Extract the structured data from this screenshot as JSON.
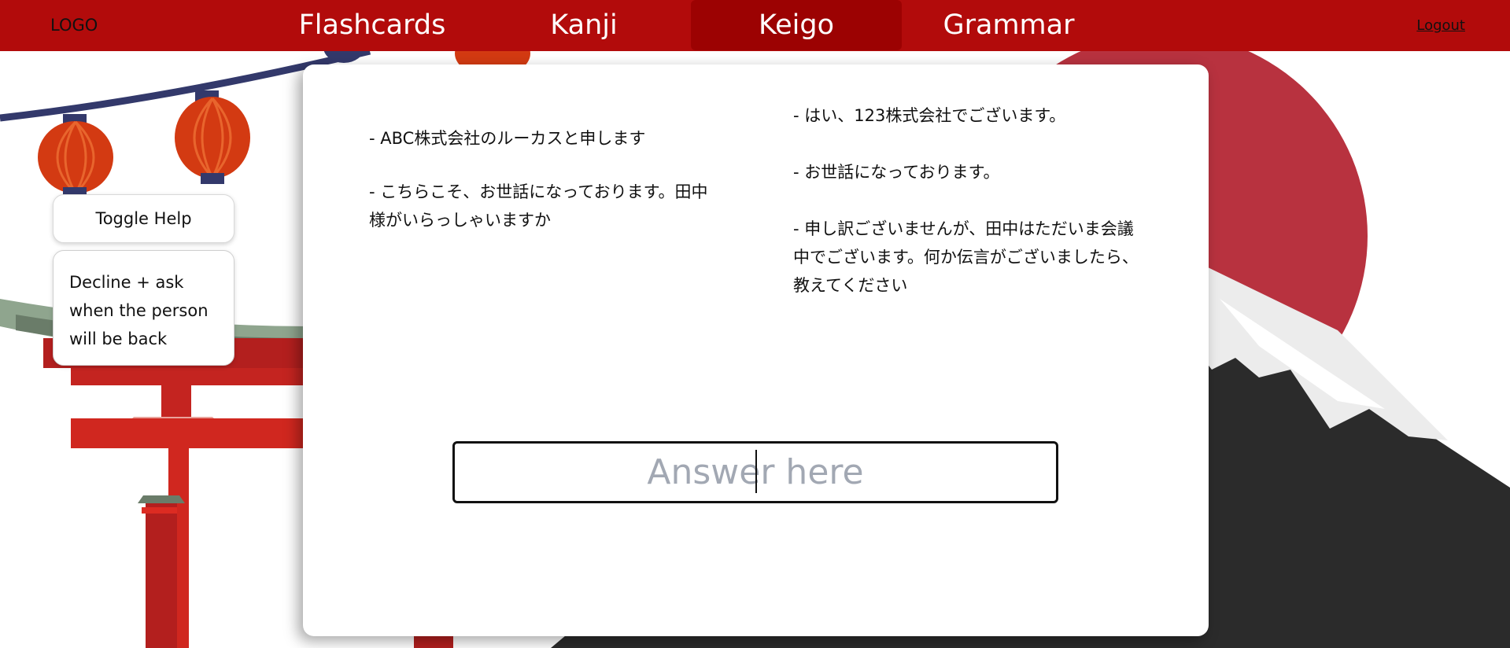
{
  "nav": {
    "logo": "LOGO",
    "tabs": [
      {
        "label": "Flashcards"
      },
      {
        "label": "Kanji"
      },
      {
        "label": "Keigo",
        "active": true
      },
      {
        "label": "Grammar"
      }
    ],
    "logout": "Logout"
  },
  "help": {
    "toggle_label": "Toggle Help",
    "hint": "Decline + ask when the person will be back"
  },
  "dialogue": {
    "left": [
      "- ABC株式会社のルーカスと申します",
      "- こちらこそ、お世話になっております。田中様がいらっしゃいますか"
    ],
    "right": [
      "- はい、123株式会社でございます。",
      "- お世話になっております。",
      "- 申し訳ございませんが、田中はただいま会議中でございます。何か伝言がございましたら、教えてください"
    ]
  },
  "answer": {
    "placeholder": "Answer here",
    "value": ""
  },
  "colors": {
    "nav_bg": "#b20b0b",
    "nav_active": "#9c0202",
    "sun": "#b8323f",
    "mountain": "#2b2b2b",
    "torii": "#d0271f",
    "lantern": "#d33a12"
  }
}
